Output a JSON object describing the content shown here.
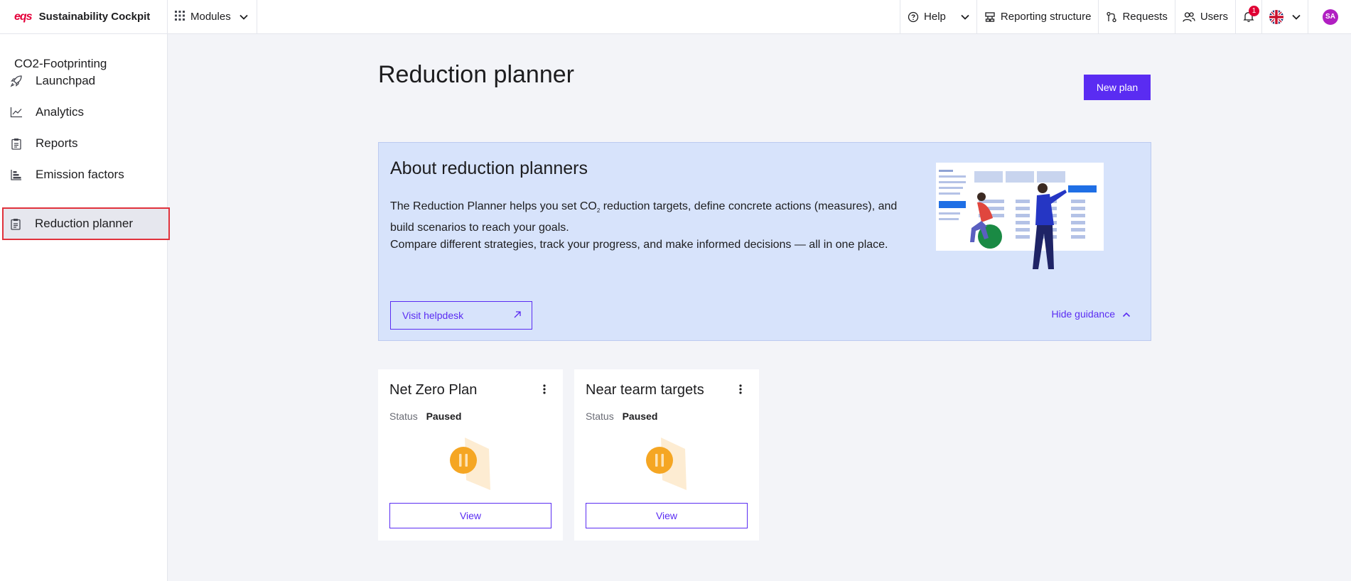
{
  "topbar": {
    "logo_text": "eqs",
    "app_name": "Sustainability Cockpit",
    "modules_label": "Modules",
    "help_label": "Help",
    "reporting_label": "Reporting structure",
    "requests_label": "Requests",
    "users_label": "Users",
    "notification_count": "1",
    "avatar_initials": "SA",
    "icons": [
      "grid-icon",
      "help-circle-icon",
      "reporting-structure-icon",
      "requests-icon",
      "users-icon",
      "bell-icon",
      "uk-flag-icon",
      "chevron-down-icon"
    ]
  },
  "sidebar": {
    "title": "CO2-Footprinting",
    "items": [
      {
        "label": "Launchpad",
        "icon": "rocket-icon"
      },
      {
        "label": "Analytics",
        "icon": "chart-line-icon"
      },
      {
        "label": "Reports",
        "icon": "clipboard-icon"
      },
      {
        "label": "Emission factors",
        "icon": "bar-list-icon"
      },
      {
        "label": "Reduction planner",
        "icon": "clipboard-icon",
        "active": true
      }
    ]
  },
  "main": {
    "title": "Reduction planner",
    "new_plan_label": "New plan",
    "about": {
      "title": "About reduction planners",
      "body_pre": "The Reduction Planner helps you set CO",
      "body_sub": "2",
      "body_post": " reduction targets, define concrete actions (measures), and build scenarios to reach your goals.",
      "body_line2": "Compare different strategies, track your progress, and make informed decisions — all in one place.",
      "helpdesk_label": "Visit helpdesk",
      "hide_label": "Hide guidance"
    },
    "plans": [
      {
        "title": "Net Zero Plan",
        "status_label": "Status",
        "status": "Paused",
        "view_label": "View"
      },
      {
        "title": "Near tearm targets",
        "status_label": "Status",
        "status": "Paused",
        "view_label": "View"
      }
    ]
  },
  "colors": {
    "accent": "#5a2cf2",
    "brand_red": "#e5003a",
    "about_bg": "#d7e3fb",
    "paused": "#f5a623",
    "highlight": "#e0323c"
  }
}
